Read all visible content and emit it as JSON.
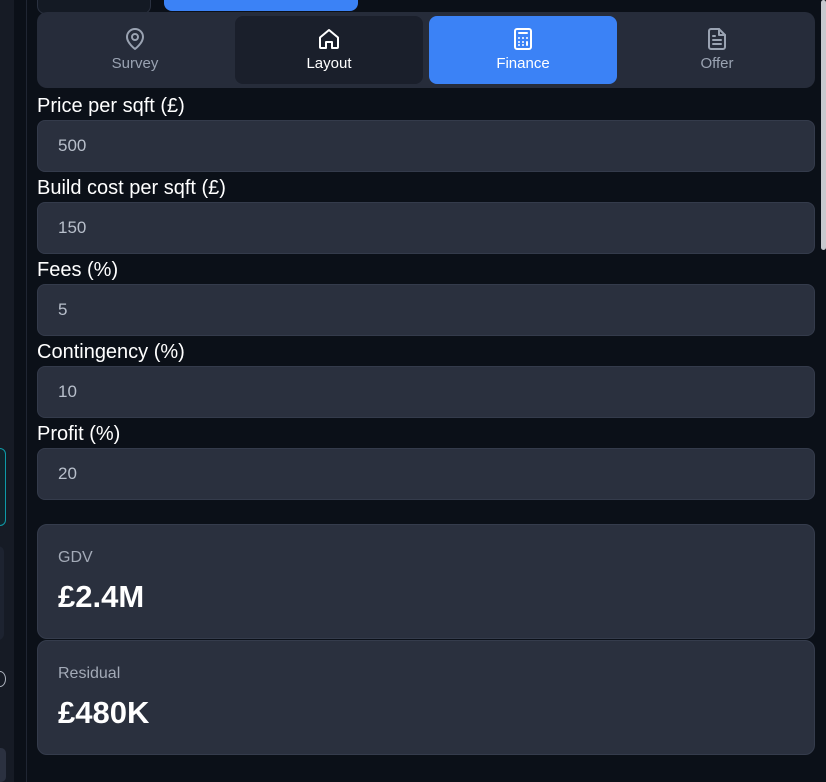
{
  "tabs": [
    {
      "label": "Survey",
      "icon": "map-pin-icon"
    },
    {
      "label": "Layout",
      "icon": "home-icon"
    },
    {
      "label": "Finance",
      "icon": "calculator-icon"
    },
    {
      "label": "Offer",
      "icon": "document-icon"
    }
  ],
  "active_tab": "Finance",
  "form": {
    "price_per_sqft": {
      "label": "Price per sqft (£)",
      "value": "500"
    },
    "build_cost_per_sqft": {
      "label": "Build cost per sqft (£)",
      "value": "150"
    },
    "fees": {
      "label": "Fees (%)",
      "value": "5"
    },
    "contingency": {
      "label": "Contingency (%)",
      "value": "10"
    },
    "profit": {
      "label": "Profit (%)",
      "value": "20"
    }
  },
  "results": {
    "gdv": {
      "label": "GDV",
      "value": "£2.4M"
    },
    "residual": {
      "label": "Residual",
      "value": "£480K"
    }
  },
  "colors": {
    "accent": "#3b82f6",
    "background": "#0b1018",
    "panel": "#2a303e",
    "teal_border": "#0e9aa7"
  }
}
